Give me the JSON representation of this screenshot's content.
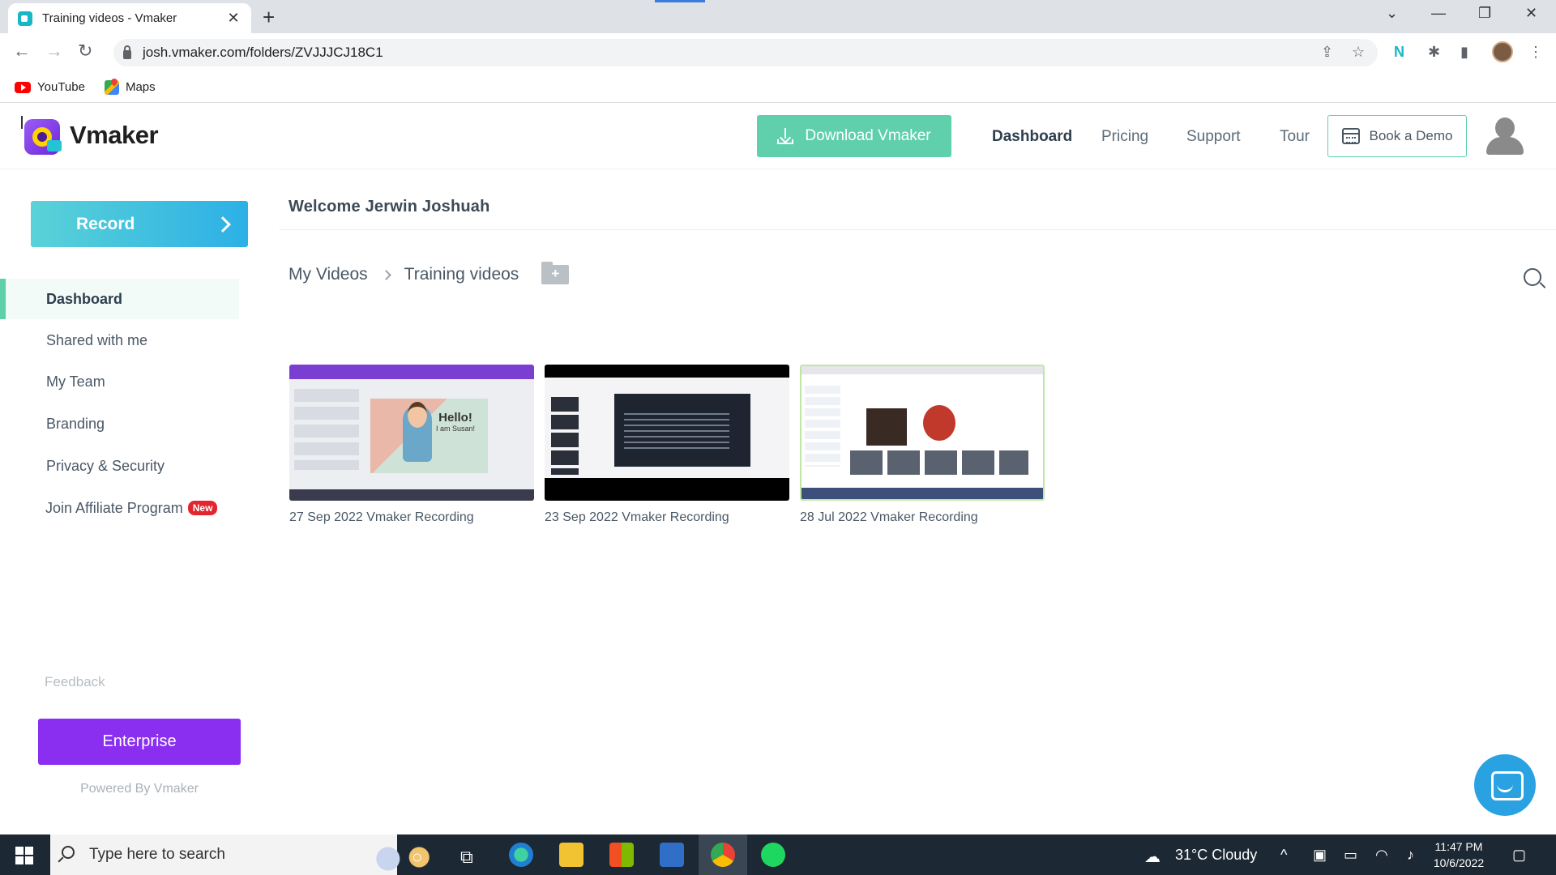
{
  "browser": {
    "tab_title": "Training videos - Vmaker",
    "url": "josh.vmaker.com/folders/ZVJJJCJ18C1",
    "bookmarks": [
      {
        "label": "YouTube",
        "icon": "youtube-icon"
      },
      {
        "label": "Maps",
        "icon": "maps-icon"
      }
    ]
  },
  "header": {
    "logo_text": "Vmaker",
    "download_label": "Download Vmaker",
    "nav": [
      {
        "label": "Dashboard",
        "active": true
      },
      {
        "label": "Pricing",
        "active": false
      },
      {
        "label": "Support",
        "active": false
      },
      {
        "label": "Tour",
        "active": false
      }
    ],
    "demo_label": "Book a Demo"
  },
  "sidebar": {
    "record_label": "Record",
    "items": [
      {
        "label": "Dashboard",
        "active": true
      },
      {
        "label": "Shared with me",
        "active": false
      },
      {
        "label": "My Team",
        "active": false
      },
      {
        "label": "Branding",
        "active": false
      },
      {
        "label": "Privacy & Security",
        "active": false
      },
      {
        "label": "Join Affiliate Program",
        "active": false,
        "badge": "New"
      }
    ],
    "feedback_label": "Feedback",
    "enterprise_label": "Enterprise",
    "powered_by": "Powered By Vmaker"
  },
  "main": {
    "welcome": "Welcome Jerwin Joshuah",
    "breadcrumb": [
      "My Videos",
      "Training videos"
    ],
    "videos": [
      {
        "title": "27 Sep 2022 Vmaker Recording",
        "thumb_text": "Hello!",
        "thumb_subtext": "I am Susan!"
      },
      {
        "title": "23 Sep 2022 Vmaker Recording"
      },
      {
        "title": "28 Jul 2022 Vmaker Recording"
      }
    ]
  },
  "taskbar": {
    "search_placeholder": "Type here to search",
    "weather": "31°C  Cloudy",
    "time": "11:47 PM",
    "date": "10/6/2022"
  },
  "colors": {
    "accent_green": "#5fcfac",
    "record_gradient": "#2cb0e6",
    "enterprise_purple": "#8a2ef0",
    "badge_red": "#e3262e"
  }
}
